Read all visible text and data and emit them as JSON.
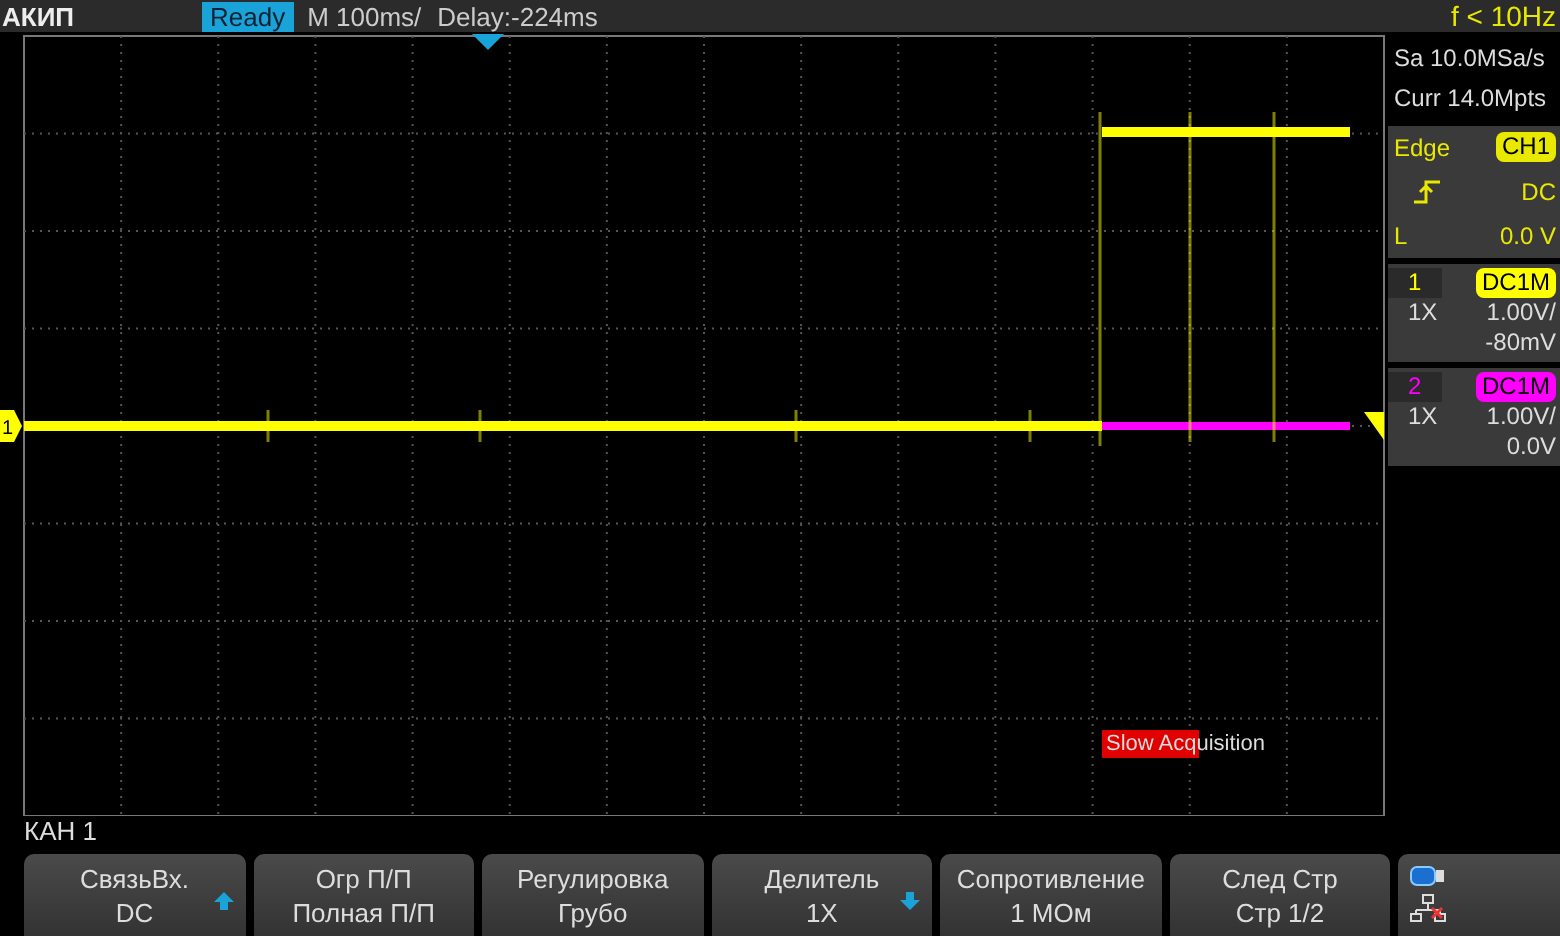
{
  "top_bar": {
    "brand": "АКИП",
    "status": "Ready",
    "timebase": "M 100ms/",
    "delay": "Delay:-224ms",
    "frequency": "f < 10Hz"
  },
  "acquisition": {
    "sample_rate": "Sa 10.0MSa/s",
    "memory_depth": "Curr 14.0Mpts"
  },
  "trigger": {
    "type": "Edge",
    "source": "CH1",
    "coupling": "DC",
    "level_label": "L",
    "level_value": "0.0 V"
  },
  "channels": [
    {
      "number": "1",
      "screen_marker": "1",
      "coupling": "DC1M",
      "probe": "1X",
      "scale": "1.00V/",
      "offset": "-80mV",
      "color": "#ffff00"
    },
    {
      "number": "2",
      "coupling": "DC1M",
      "probe": "1X",
      "scale": "1.00V/",
      "offset": "0.0V",
      "color": "#ff00ff"
    }
  ],
  "notice": "Slow Acquisition",
  "menu_title": "КАН 1",
  "softkeys": [
    {
      "kind": "arrow-up",
      "label": "СвязьВх.",
      "value": "DC"
    },
    {
      "kind": "plain",
      "label": "Огр П/П",
      "value": "Полная П/П"
    },
    {
      "kind": "plain",
      "label": "Регулировка",
      "value": "Грубо"
    },
    {
      "kind": "arrow-down",
      "label": "Делитель",
      "value": "1X"
    },
    {
      "kind": "plain",
      "label": "Сопротивление",
      "value": "1 МОм"
    },
    {
      "kind": "plain",
      "label": "След Стр",
      "value": "Стр 1/2"
    }
  ]
}
